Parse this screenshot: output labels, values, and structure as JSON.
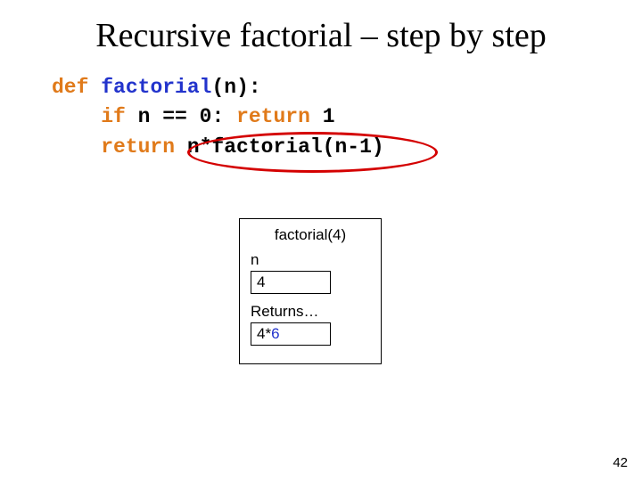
{
  "title": "Recursive factorial – step by step",
  "code": {
    "l1": {
      "def": "def",
      "fname": "factorial",
      "lparen": "(",
      "arg": "n",
      "rparen_colon": "):"
    },
    "l2": {
      "if_": "if",
      "cond": " n == 0: ",
      "ret": "return",
      "one": " 1"
    },
    "l3": {
      "ret": "return",
      "expr": " n*factorial(n-1)"
    }
  },
  "frame": {
    "call": "factorial(4)",
    "var_label": "n",
    "var_value": "4",
    "returns_label": "Returns…",
    "ret_left": "4*",
    "ret_right": "6"
  },
  "page": "42"
}
